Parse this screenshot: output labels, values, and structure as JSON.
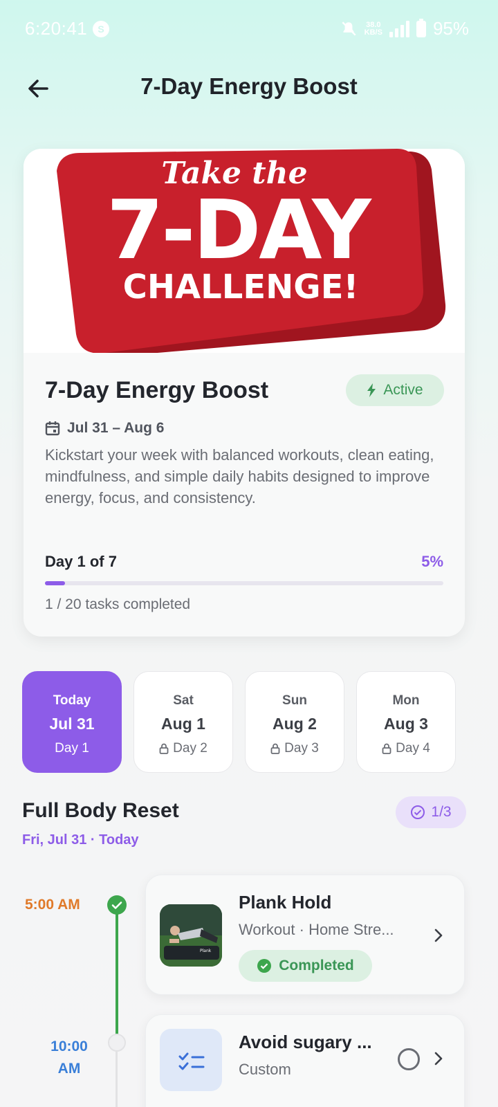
{
  "status_bar": {
    "time": "6:20:41",
    "net_speed_top": "38.0",
    "net_speed_bottom": "KB/S",
    "battery": "95%"
  },
  "header": {
    "title": "7-Day Energy Boost"
  },
  "banner": {
    "line1": "Take the",
    "line2": "7-DAY",
    "line3": "CHALLENGE!"
  },
  "challenge": {
    "title": "7-Day Energy Boost",
    "status": "Active",
    "date_range": "Jul 31 – Aug 6",
    "description": "Kickstart your week with balanced workouts, clean eating, mindfulness, and simple daily habits designed to improve energy, focus, and consistency.",
    "day_label": "Day 1 of 7",
    "percent": "5%",
    "progress_fraction": 0.05,
    "tasks_completed": "1 / 20 tasks completed"
  },
  "days": [
    {
      "dow": "Today",
      "date": "Jul 31",
      "day": "Day 1",
      "selected": true,
      "locked": false
    },
    {
      "dow": "Sat",
      "date": "Aug 1",
      "day": "Day 2",
      "selected": false,
      "locked": true
    },
    {
      "dow": "Sun",
      "date": "Aug 2",
      "day": "Day 3",
      "selected": false,
      "locked": true
    },
    {
      "dow": "Mon",
      "date": "Aug 3",
      "day": "Day 4",
      "selected": false,
      "locked": true
    }
  ],
  "section": {
    "title": "Full Body Reset",
    "subtitle": "Fri, Jul 31 · Today",
    "count": "1/3"
  },
  "tasks": [
    {
      "time": "5:00 AM",
      "title": "Plank Hold",
      "meta": "Workout · Home Stre...",
      "status": "Completed",
      "thumb_caption": "Plank"
    },
    {
      "time": "10:00 AM",
      "title": "Avoid sugary ...",
      "meta": "Custom"
    }
  ],
  "colors": {
    "accent": "#8d5ce8",
    "success": "#3da64d",
    "banner_red": "#c8202c"
  }
}
